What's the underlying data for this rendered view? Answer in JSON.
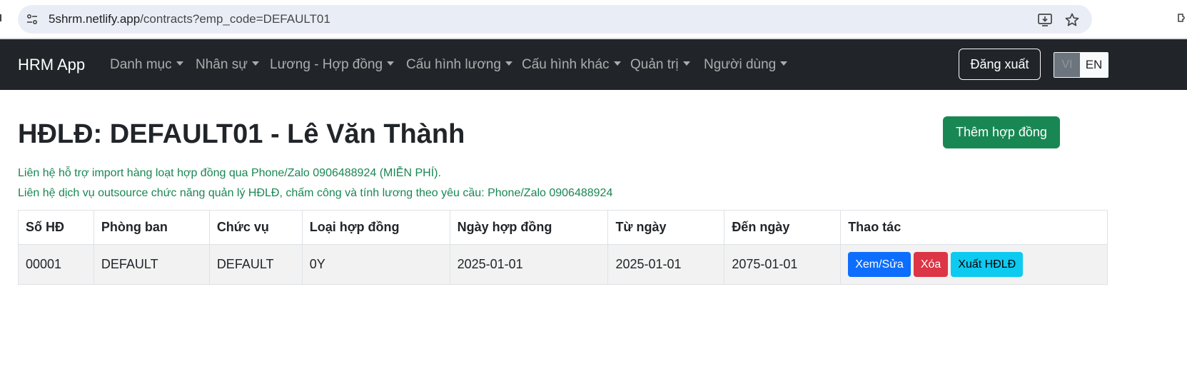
{
  "browser": {
    "url_host": "5shrm.netlify.app",
    "url_path": "/contracts?emp_code=DEFAULT01",
    "icons": [
      "site-settings-icon",
      "install-app-icon",
      "star-bookmark-icon",
      "extensions-icon"
    ]
  },
  "navbar": {
    "brand": "HRM App",
    "items": [
      {
        "label": "Danh mục"
      },
      {
        "label": "Nhân sự"
      },
      {
        "label": "Lương - Hợp đồng"
      },
      {
        "label": "Cấu hình lương"
      },
      {
        "label": "Cấu hình khác"
      },
      {
        "label": "Quản trị"
      },
      {
        "label": "Người dùng"
      }
    ],
    "logout_label": "Đăng xuất",
    "lang_vi": "VI",
    "lang_en": "EN"
  },
  "main": {
    "title": "HĐLĐ: DEFAULT01 - Lê Văn Thành",
    "add_button": "Thêm hợp đồng",
    "notice_1": "Liên hệ hỗ trợ import hàng loạt hợp đồng qua Phone/Zalo 0906488924 (MIỄN PHÍ).",
    "notice_2": "Liên hệ dịch vụ outsource chức năng quản lý HĐLĐ, chấm công và tính lương theo yêu cầu: Phone/Zalo 0906488924"
  },
  "table": {
    "headers": [
      "Số HĐ",
      "Phòng ban",
      "Chức vụ",
      "Loại hợp đồng",
      "Ngày hợp đồng",
      "Từ ngày",
      "Đến ngày",
      "Thao tác"
    ],
    "rows": [
      {
        "so_hd": "00001",
        "phong_ban": "DEFAULT",
        "chuc_vu": "DEFAULT",
        "loai_hd": "0Y",
        "ngay_hd": "2025-01-01",
        "tu_ngay": "2025-01-01",
        "den_ngay": "2075-01-01",
        "actions": {
          "view": "Xem/Sửa",
          "delete": "Xóa",
          "export": "Xuất HĐLĐ"
        }
      }
    ]
  },
  "colors": {
    "navbar_bg": "#212529",
    "success": "#198754",
    "primary": "#0d6efd",
    "danger": "#dc3545",
    "info": "#0dcaf0"
  }
}
